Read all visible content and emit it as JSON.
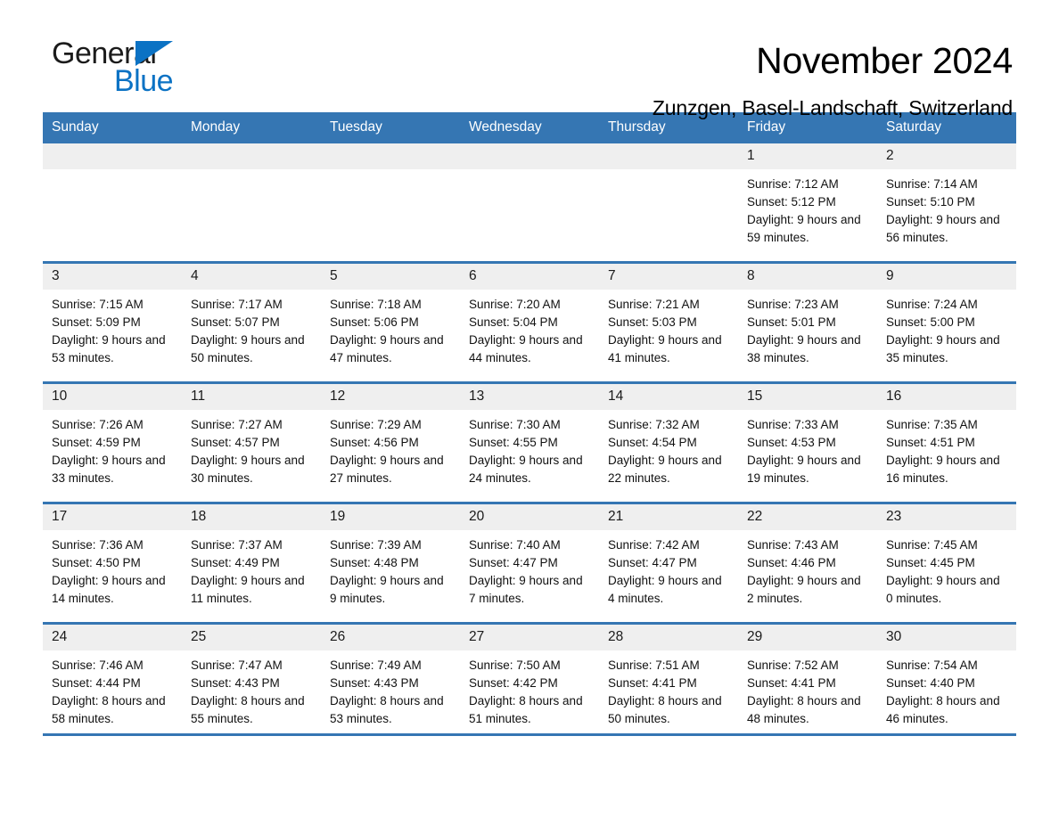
{
  "brand": {
    "name_top": "General",
    "name_bottom": "Blue",
    "triangle_color": "#0b72c4"
  },
  "header": {
    "month_title": "November 2024",
    "location": "Zunzgen, Basel-Landschaft, Switzerland"
  },
  "theme": {
    "header_blue": "#3576b3",
    "day_band_gray": "#efefef",
    "text": "#111111"
  },
  "calendar": {
    "weekday_headers": [
      "Sunday",
      "Monday",
      "Tuesday",
      "Wednesday",
      "Thursday",
      "Friday",
      "Saturday"
    ],
    "weeks": [
      [
        {
          "day": "",
          "sunrise": "",
          "sunset": "",
          "daylight": "",
          "empty": true
        },
        {
          "day": "",
          "sunrise": "",
          "sunset": "",
          "daylight": "",
          "empty": true
        },
        {
          "day": "",
          "sunrise": "",
          "sunset": "",
          "daylight": "",
          "empty": true
        },
        {
          "day": "",
          "sunrise": "",
          "sunset": "",
          "daylight": "",
          "empty": true
        },
        {
          "day": "",
          "sunrise": "",
          "sunset": "",
          "daylight": "",
          "empty": true
        },
        {
          "day": "1",
          "sunrise": "Sunrise: 7:12 AM",
          "sunset": "Sunset: 5:12 PM",
          "daylight": "Daylight: 9 hours and 59 minutes.",
          "empty": false
        },
        {
          "day": "2",
          "sunrise": "Sunrise: 7:14 AM",
          "sunset": "Sunset: 5:10 PM",
          "daylight": "Daylight: 9 hours and 56 minutes.",
          "empty": false
        }
      ],
      [
        {
          "day": "3",
          "sunrise": "Sunrise: 7:15 AM",
          "sunset": "Sunset: 5:09 PM",
          "daylight": "Daylight: 9 hours and 53 minutes.",
          "empty": false
        },
        {
          "day": "4",
          "sunrise": "Sunrise: 7:17 AM",
          "sunset": "Sunset: 5:07 PM",
          "daylight": "Daylight: 9 hours and 50 minutes.",
          "empty": false
        },
        {
          "day": "5",
          "sunrise": "Sunrise: 7:18 AM",
          "sunset": "Sunset: 5:06 PM",
          "daylight": "Daylight: 9 hours and 47 minutes.",
          "empty": false
        },
        {
          "day": "6",
          "sunrise": "Sunrise: 7:20 AM",
          "sunset": "Sunset: 5:04 PM",
          "daylight": "Daylight: 9 hours and 44 minutes.",
          "empty": false
        },
        {
          "day": "7",
          "sunrise": "Sunrise: 7:21 AM",
          "sunset": "Sunset: 5:03 PM",
          "daylight": "Daylight: 9 hours and 41 minutes.",
          "empty": false
        },
        {
          "day": "8",
          "sunrise": "Sunrise: 7:23 AM",
          "sunset": "Sunset: 5:01 PM",
          "daylight": "Daylight: 9 hours and 38 minutes.",
          "empty": false
        },
        {
          "day": "9",
          "sunrise": "Sunrise: 7:24 AM",
          "sunset": "Sunset: 5:00 PM",
          "daylight": "Daylight: 9 hours and 35 minutes.",
          "empty": false
        }
      ],
      [
        {
          "day": "10",
          "sunrise": "Sunrise: 7:26 AM",
          "sunset": "Sunset: 4:59 PM",
          "daylight": "Daylight: 9 hours and 33 minutes.",
          "empty": false
        },
        {
          "day": "11",
          "sunrise": "Sunrise: 7:27 AM",
          "sunset": "Sunset: 4:57 PM",
          "daylight": "Daylight: 9 hours and 30 minutes.",
          "empty": false
        },
        {
          "day": "12",
          "sunrise": "Sunrise: 7:29 AM",
          "sunset": "Sunset: 4:56 PM",
          "daylight": "Daylight: 9 hours and 27 minutes.",
          "empty": false
        },
        {
          "day": "13",
          "sunrise": "Sunrise: 7:30 AM",
          "sunset": "Sunset: 4:55 PM",
          "daylight": "Daylight: 9 hours and 24 minutes.",
          "empty": false
        },
        {
          "day": "14",
          "sunrise": "Sunrise: 7:32 AM",
          "sunset": "Sunset: 4:54 PM",
          "daylight": "Daylight: 9 hours and 22 minutes.",
          "empty": false
        },
        {
          "day": "15",
          "sunrise": "Sunrise: 7:33 AM",
          "sunset": "Sunset: 4:53 PM",
          "daylight": "Daylight: 9 hours and 19 minutes.",
          "empty": false
        },
        {
          "day": "16",
          "sunrise": "Sunrise: 7:35 AM",
          "sunset": "Sunset: 4:51 PM",
          "daylight": "Daylight: 9 hours and 16 minutes.",
          "empty": false
        }
      ],
      [
        {
          "day": "17",
          "sunrise": "Sunrise: 7:36 AM",
          "sunset": "Sunset: 4:50 PM",
          "daylight": "Daylight: 9 hours and 14 minutes.",
          "empty": false
        },
        {
          "day": "18",
          "sunrise": "Sunrise: 7:37 AM",
          "sunset": "Sunset: 4:49 PM",
          "daylight": "Daylight: 9 hours and 11 minutes.",
          "empty": false
        },
        {
          "day": "19",
          "sunrise": "Sunrise: 7:39 AM",
          "sunset": "Sunset: 4:48 PM",
          "daylight": "Daylight: 9 hours and 9 minutes.",
          "empty": false
        },
        {
          "day": "20",
          "sunrise": "Sunrise: 7:40 AM",
          "sunset": "Sunset: 4:47 PM",
          "daylight": "Daylight: 9 hours and 7 minutes.",
          "empty": false
        },
        {
          "day": "21",
          "sunrise": "Sunrise: 7:42 AM",
          "sunset": "Sunset: 4:47 PM",
          "daylight": "Daylight: 9 hours and 4 minutes.",
          "empty": false
        },
        {
          "day": "22",
          "sunrise": "Sunrise: 7:43 AM",
          "sunset": "Sunset: 4:46 PM",
          "daylight": "Daylight: 9 hours and 2 minutes.",
          "empty": false
        },
        {
          "day": "23",
          "sunrise": "Sunrise: 7:45 AM",
          "sunset": "Sunset: 4:45 PM",
          "daylight": "Daylight: 9 hours and 0 minutes.",
          "empty": false
        }
      ],
      [
        {
          "day": "24",
          "sunrise": "Sunrise: 7:46 AM",
          "sunset": "Sunset: 4:44 PM",
          "daylight": "Daylight: 8 hours and 58 minutes.",
          "empty": false
        },
        {
          "day": "25",
          "sunrise": "Sunrise: 7:47 AM",
          "sunset": "Sunset: 4:43 PM",
          "daylight": "Daylight: 8 hours and 55 minutes.",
          "empty": false
        },
        {
          "day": "26",
          "sunrise": "Sunrise: 7:49 AM",
          "sunset": "Sunset: 4:43 PM",
          "daylight": "Daylight: 8 hours and 53 minutes.",
          "empty": false
        },
        {
          "day": "27",
          "sunrise": "Sunrise: 7:50 AM",
          "sunset": "Sunset: 4:42 PM",
          "daylight": "Daylight: 8 hours and 51 minutes.",
          "empty": false
        },
        {
          "day": "28",
          "sunrise": "Sunrise: 7:51 AM",
          "sunset": "Sunset: 4:41 PM",
          "daylight": "Daylight: 8 hours and 50 minutes.",
          "empty": false
        },
        {
          "day": "29",
          "sunrise": "Sunrise: 7:52 AM",
          "sunset": "Sunset: 4:41 PM",
          "daylight": "Daylight: 8 hours and 48 minutes.",
          "empty": false
        },
        {
          "day": "30",
          "sunrise": "Sunrise: 7:54 AM",
          "sunset": "Sunset: 4:40 PM",
          "daylight": "Daylight: 8 hours and 46 minutes.",
          "empty": false
        }
      ]
    ]
  }
}
